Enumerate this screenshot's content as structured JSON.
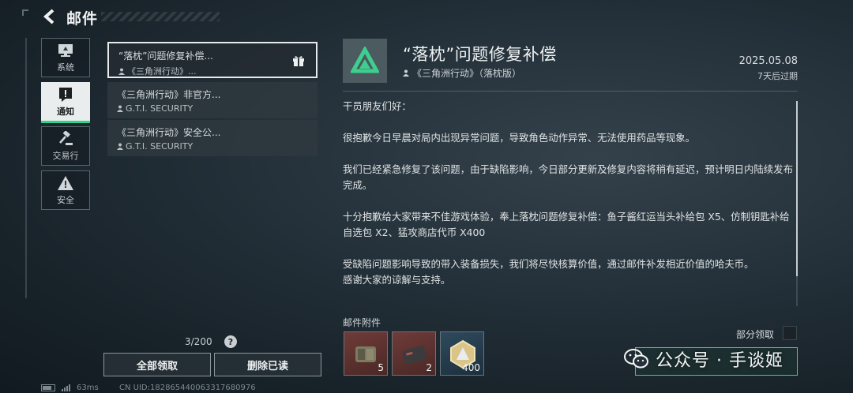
{
  "header": {
    "title": "邮件",
    "back_icon": "back-arrow-icon"
  },
  "categories": [
    {
      "label": "系统",
      "icon": "monitor-icon",
      "active": false
    },
    {
      "label": "通知",
      "icon": "alert-notice-icon",
      "active": true
    },
    {
      "label": "交易行",
      "icon": "gavel-icon",
      "active": false
    },
    {
      "label": "安全",
      "icon": "warning-triangle-icon",
      "active": false
    }
  ],
  "mail_list": [
    {
      "title": "“落枕”问题修复补偿...",
      "sender": "《三角洲行动》...",
      "has_gift": true,
      "selected": true
    },
    {
      "title": "《三角洲行动》非官方...",
      "sender": "G.T.I. SECURITY",
      "has_gift": false,
      "selected": false
    },
    {
      "title": "《三角洲行动》安全公...",
      "sender": "G.T.I. SECURITY",
      "has_gift": false,
      "selected": false
    }
  ],
  "list_footer": {
    "counter": "3/200",
    "help": "?",
    "claim_all": "全部领取",
    "delete_read": "删除已读"
  },
  "status": {
    "ping": "63ms",
    "uid": "CN UID:182865440063317680976"
  },
  "detail": {
    "title": "“落枕”问题修复补偿",
    "sender": "《三角洲行动》（落枕版）",
    "date": "2025.05.08",
    "expire": "7天后过期",
    "paragraphs": [
      "干员朋友们好：",
      "很抱歉今日早晨对局内出现异常问题，导致角色动作异常、无法使用药品等现象。",
      "我们已经紧急修复了该问题，由于缺陷影响，今日部分更新及修复内容将稍有延迟，预计明日内陆续发布完成。",
      "十分抱歉给大家带来不佳游戏体验，奉上落枕问题修复补偿：鱼子酱红运当头补给包 X5、仿制钥匙补给自选包 X2、猛攻商店代币 X400",
      "受缺陷问题影响导致的带入装备损失，我们将尽快核算价值，通过邮件补发相近价值的哈夫币。",
      "感谢大家的谅解与支持。"
    ],
    "attachments_label": "邮件附件",
    "partial_claim_label": "部分领取",
    "attachments": [
      {
        "icon": "supply-pack-icon",
        "qty": "5",
        "color": "red"
      },
      {
        "icon": "key-pack-icon",
        "qty": "2",
        "color": "red"
      },
      {
        "icon": "token-coin-icon",
        "qty": "400",
        "color": "blue"
      }
    ]
  },
  "watermark": {
    "text": "公众号 · 手谈姬",
    "icon": "wechat-icon"
  },
  "colors": {
    "accent": "#2fd38a",
    "logo_green": "#3ecf8e",
    "panel_bg": "#24313a"
  }
}
